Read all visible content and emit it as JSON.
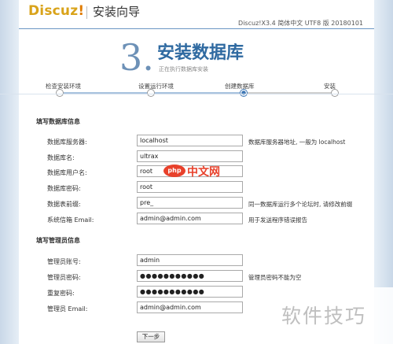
{
  "header": {
    "logo": "Discuz",
    "logo_bang": "!",
    "wizard_title": "安装向导",
    "version": "Discuz!X3.4 简体中文 UTF8 版 20180101"
  },
  "step": {
    "number": "3.",
    "title": "安装数据库",
    "subtitle": "正在执行数据库安装"
  },
  "progress": {
    "current_step": 3,
    "steps": [
      {
        "label": "检查安装环境"
      },
      {
        "label": "设置运行环境"
      },
      {
        "label": "创建数据库"
      },
      {
        "label": "安装"
      }
    ]
  },
  "db_section": {
    "title": "填写数据库信息",
    "fields": [
      {
        "label": "数据库服务器:",
        "value": "localhost",
        "hint": "数据库服务器地址, 一般为 localhost"
      },
      {
        "label": "数据库名:",
        "value": "ultrax",
        "hint": ""
      },
      {
        "label": "数据库用户名:",
        "value": "root",
        "hint": ""
      },
      {
        "label": "数据库密码:",
        "value": "root",
        "hint": ""
      },
      {
        "label": "数据表前缀:",
        "value": "pre_",
        "hint": "同一数据库运行多个论坛时, 请修改前缀"
      },
      {
        "label": "系统信箱 Email:",
        "value": "admin@admin.com",
        "hint": "用于发送程序错误报告"
      }
    ]
  },
  "admin_section": {
    "title": "填写管理员信息",
    "fields": [
      {
        "label": "管理员账号:",
        "value": "admin",
        "hint": ""
      },
      {
        "label": "管理员密码:",
        "value": "●●●●●●●●●●●",
        "hint": "管理员密码不能为空"
      },
      {
        "label": "重复密码:",
        "value": "●●●●●●●●●●●",
        "hint": ""
      },
      {
        "label": "管理员 Email:",
        "value": "admin@admin.com",
        "hint": ""
      }
    ]
  },
  "next_button": "下一步",
  "watermarks": {
    "php_badge": "php",
    "php_text": "中文网",
    "corner_text": "软件技巧"
  }
}
